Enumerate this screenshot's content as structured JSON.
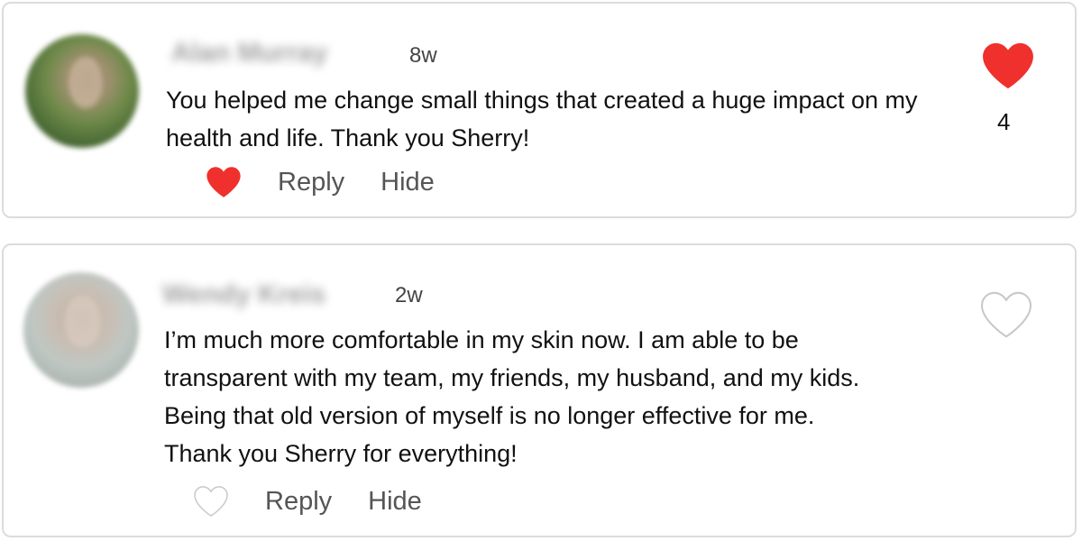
{
  "comments": [
    {
      "author": "Alan Murray",
      "time": "8w",
      "text": "You helped me change small things that created a huge impact on my\nhealth and life. Thank you Sherry!",
      "reply_label": "Reply",
      "hide_label": "Hide",
      "liked": true,
      "like_count": "4"
    },
    {
      "author": "Wendy Kreis",
      "time": "2w",
      "text": "I’m much more comfortable in my skin now. I am able to be\ntransparent with my team, my friends, my husband, and my kids.\nBeing that old version of myself is no longer effective for me.\nThank you Sherry for everything!",
      "reply_label": "Reply",
      "hide_label": "Hide",
      "liked": false
    }
  ],
  "colors": {
    "heart_red": "#f0302c",
    "heart_outline": "#c8c8c8",
    "action_text": "#555555"
  }
}
